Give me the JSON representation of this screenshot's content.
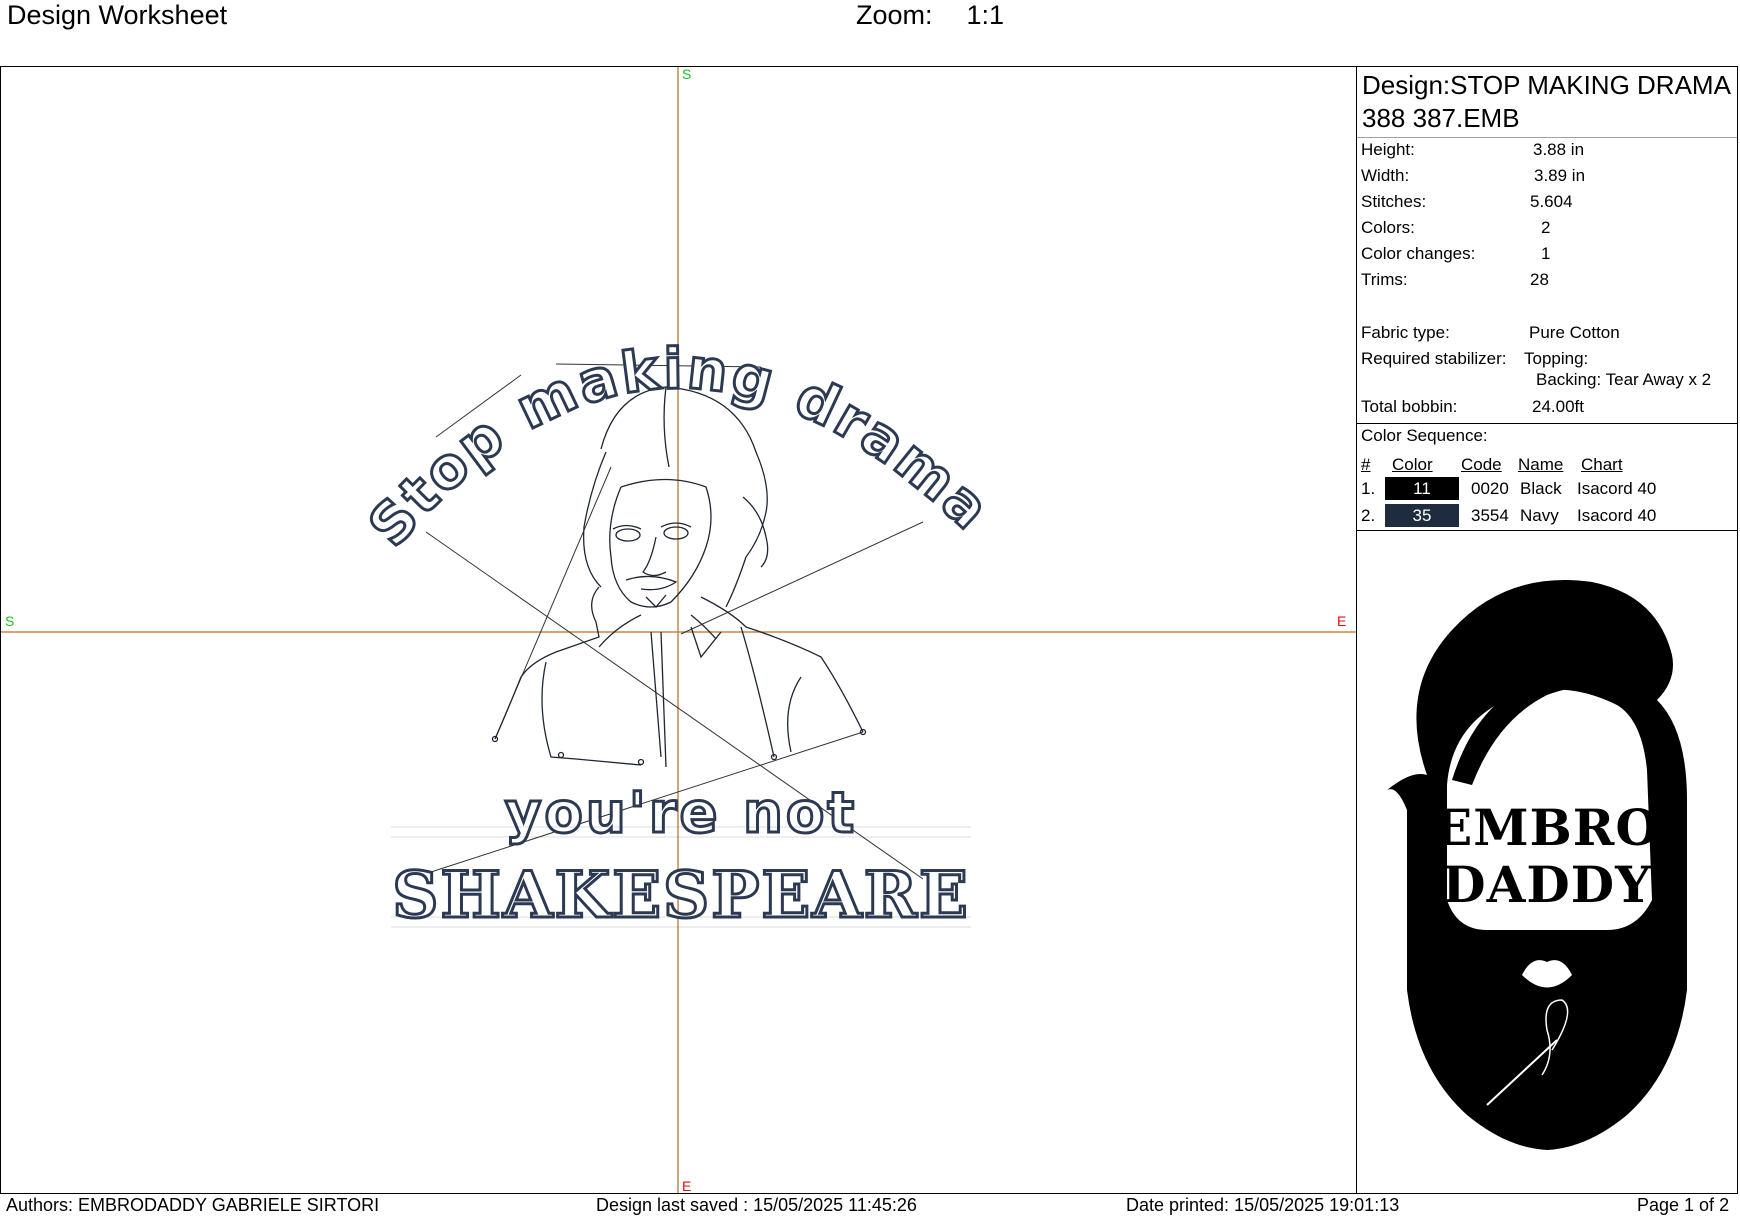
{
  "header": {
    "title": "Design Worksheet",
    "zoom_label": "Zoom:",
    "zoom_value": "1:1"
  },
  "canvas": {
    "marker_start": "S",
    "marker_end": "E",
    "text_top": "Stop making drama",
    "text_mid": "you're not",
    "text_bottom": "SHAKESPEARE",
    "thread_color": "#2b3a52",
    "axis_color": "#c8864a"
  },
  "panel": {
    "design_title": "Design:STOP MAKING DRAMA 388 387.EMB",
    "specs": [
      {
        "key": "Height:",
        "value": "3.88 in"
      },
      {
        "key": "Width:",
        "value": "3.89 in"
      },
      {
        "key": "Stitches:",
        "value": "5.604"
      },
      {
        "key": "Colors:",
        "value": "2"
      },
      {
        "key": "Color changes:",
        "value": "1"
      },
      {
        "key": "Trims:",
        "value": "28"
      }
    ],
    "fabric_label": "Fabric type:",
    "fabric_value": "Pure Cotton",
    "stabilizer_label": "Required stabilizer:",
    "topping": "Topping:",
    "backing": "Backing: Tear Away x 2",
    "bobbin_label": "Total bobbin:",
    "bobbin_value": "24.00ft",
    "color_sequence_label": "Color Sequence:",
    "columns": [
      "#",
      "Color",
      "Code",
      "Name",
      "Chart"
    ],
    "colors": [
      {
        "num": "1.",
        "color": "11",
        "swatch": "#000000",
        "code": "0020",
        "name": "Black",
        "chart": "Isacord 40"
      },
      {
        "num": "2.",
        "color": "35",
        "swatch": "#1f2b3f",
        "code": "3554",
        "name": "Navy",
        "chart": "Isacord 40"
      }
    ]
  },
  "logo": {
    "line1": "EMBRO",
    "line2": "DADDY"
  },
  "footer": {
    "authors": "Authors: EMBRODADDY GABRIELE SIRTORI",
    "saved": "Design last saved : 15/05/2025 11:45:26",
    "printed": "Date printed: 15/05/2025 19:01:13",
    "page": "Page 1 of 2"
  }
}
